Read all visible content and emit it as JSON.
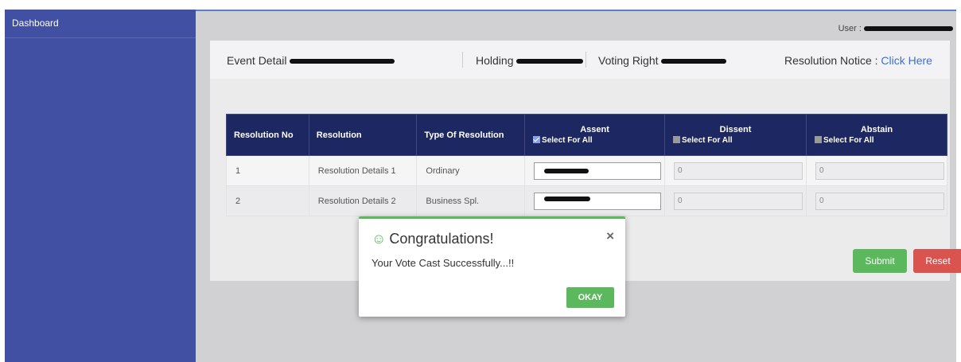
{
  "sidebar": {
    "brand": "Dashboard"
  },
  "header": {
    "user_label": "User :"
  },
  "event_bar": {
    "event_detail_label": "Event Detail",
    "holding_label": "Holding",
    "voting_right_label": "Voting Right",
    "resolution_notice_label": "Resolution Notice :",
    "resolution_notice_link": "Click Here"
  },
  "table": {
    "headers": {
      "resolution_no": "Resolution No",
      "resolution": "Resolution",
      "type": "Type Of Resolution",
      "assent": "Assent",
      "dissent": "Dissent",
      "abstain": "Abstain",
      "select_all": "Select For All"
    },
    "select_all_state": {
      "assent": true,
      "dissent": false,
      "abstain": false
    },
    "rows": [
      {
        "no": "1",
        "resolution": "Resolution Details 1",
        "type": "Ordinary",
        "dissent": "0",
        "abstain": "0"
      },
      {
        "no": "2",
        "resolution": "Resolution Details 2",
        "type": "Business Spl.",
        "dissent": "0",
        "abstain": "0"
      }
    ]
  },
  "actions": {
    "submit": "Submit",
    "reset": "Reset"
  },
  "modal": {
    "title": "Congratulations!",
    "message": "Your Vote Cast Successfully...!!",
    "close": "×",
    "ok": "OKAY"
  },
  "colors": {
    "sidebar": "#4150a3",
    "table_header": "#1d2761",
    "success": "#5cb85c",
    "danger": "#d9534f",
    "link": "#3b6fd1"
  }
}
